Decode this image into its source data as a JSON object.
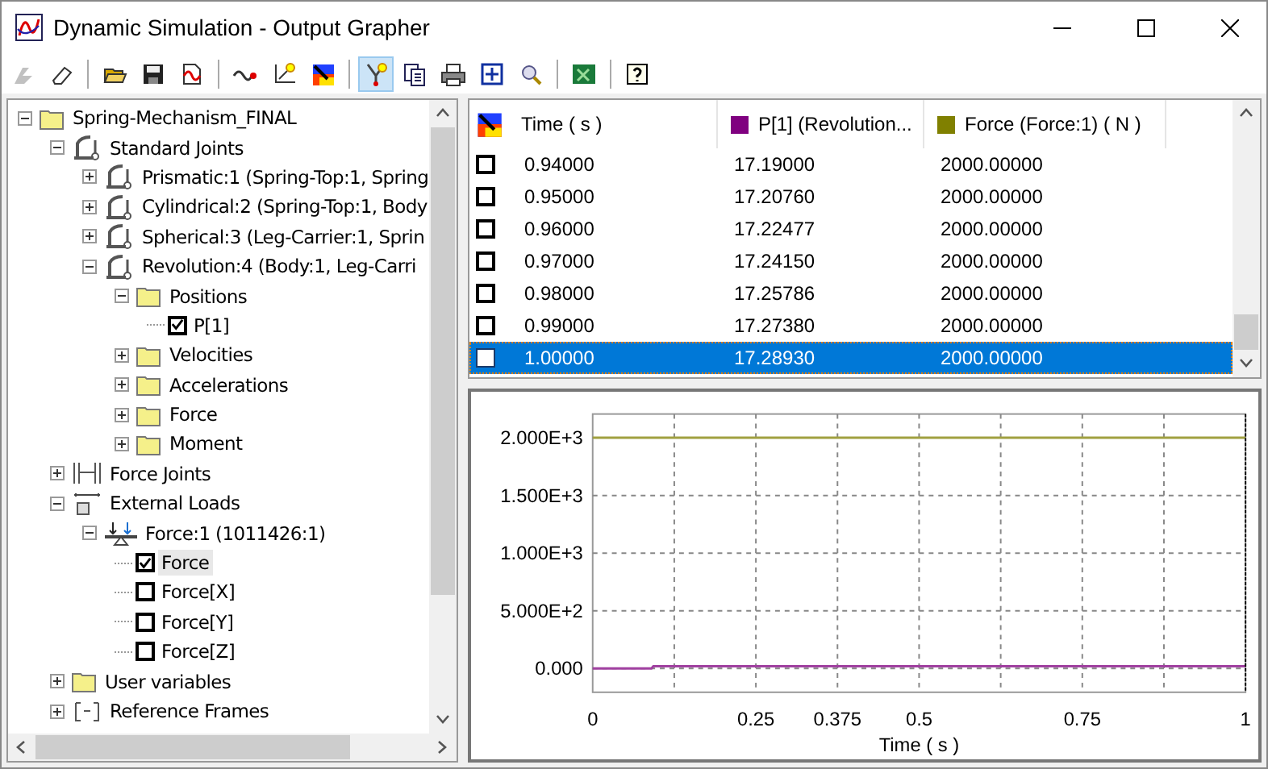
{
  "window": {
    "title": "Dynamic Simulation - Output Grapher"
  },
  "toolbar": [
    {
      "kind": "branch",
      "disabled": true,
      "on": false
    },
    {
      "kind": "eraser",
      "disabled": false,
      "on": false
    },
    {
      "kind": "sep"
    },
    {
      "kind": "open",
      "disabled": false,
      "on": false
    },
    {
      "kind": "save",
      "disabled": false,
      "on": false
    },
    {
      "kind": "export",
      "disabled": false,
      "on": false
    },
    {
      "kind": "sep"
    },
    {
      "kind": "curve",
      "disabled": false,
      "on": false
    },
    {
      "kind": "axes",
      "disabled": false,
      "on": false
    },
    {
      "kind": "colormap",
      "disabled": false,
      "on": false
    },
    {
      "kind": "sep"
    },
    {
      "kind": "cursor",
      "disabled": false,
      "on": true
    },
    {
      "kind": "copy",
      "disabled": false,
      "on": false
    },
    {
      "kind": "print",
      "disabled": false,
      "on": false
    },
    {
      "kind": "fit",
      "disabled": false,
      "on": false
    },
    {
      "kind": "zoom",
      "disabled": false,
      "on": false
    },
    {
      "kind": "sep"
    },
    {
      "kind": "excel",
      "disabled": false,
      "on": false
    },
    {
      "kind": "sep"
    },
    {
      "kind": "help",
      "disabled": false,
      "on": false
    }
  ],
  "tree": [
    {
      "kind": "folder",
      "label": "Spring-Mechanism_FINAL",
      "expanded": true,
      "children": [
        {
          "kind": "joint",
          "label": "Standard Joints",
          "expanded": true,
          "children": [
            {
              "kind": "joint",
              "label": "Prismatic:1 (Spring-Top:1, Spring",
              "expanded": false
            },
            {
              "kind": "joint",
              "label": "Cylindrical:2 (Spring-Top:1, Body",
              "expanded": false
            },
            {
              "kind": "joint",
              "label": "Spherical:3 (Leg-Carrier:1, Sprin",
              "expanded": false
            },
            {
              "kind": "joint",
              "label": "Revolution:4 (Body:1, Leg-Carri",
              "expanded": true,
              "children": [
                {
                  "kind": "folder",
                  "label": "Positions",
                  "expanded": true,
                  "children": [
                    {
                      "kind": "check",
                      "label": "P[1]",
                      "checked": true,
                      "selected": false
                    }
                  ]
                },
                {
                  "kind": "folder",
                  "label": "Velocities",
                  "expanded": false
                },
                {
                  "kind": "folder",
                  "label": "Accelerations",
                  "expanded": false
                },
                {
                  "kind": "folder",
                  "label": "Force",
                  "expanded": false
                },
                {
                  "kind": "folder",
                  "label": "Moment",
                  "expanded": false
                }
              ]
            }
          ]
        },
        {
          "kind": "forcejoint",
          "label": "Force Joints",
          "expanded": false
        },
        {
          "kind": "loads",
          "label": "External Loads",
          "expanded": true,
          "children": [
            {
              "kind": "force",
              "label": "Force:1 (1011426:1)",
              "expanded": true,
              "children": [
                {
                  "kind": "check",
                  "label": "Force",
                  "checked": true,
                  "selected": true
                },
                {
                  "kind": "check",
                  "label": "Force[X]",
                  "checked": false,
                  "selected": false
                },
                {
                  "kind": "check",
                  "label": "Force[Y]",
                  "checked": false,
                  "selected": false
                },
                {
                  "kind": "check",
                  "label": "Force[Z]",
                  "checked": false,
                  "selected": false
                }
              ]
            }
          ]
        },
        {
          "kind": "folder",
          "label": "User variables",
          "expanded": false
        },
        {
          "kind": "frames",
          "label": "Reference Frames",
          "expanded": false
        }
      ]
    }
  ],
  "table": {
    "columns": [
      {
        "label": "Time ( s )"
      },
      {
        "label": "P[1] (Revolution...",
        "color": "#800080"
      },
      {
        "label": "Force (Force:1) ( N )",
        "color": "#808000"
      }
    ],
    "rows": [
      {
        "checked": false,
        "selected": false,
        "cells": [
          "0.94000",
          "17.19000",
          "2000.00000"
        ]
      },
      {
        "checked": false,
        "selected": false,
        "cells": [
          "0.95000",
          "17.20760",
          "2000.00000"
        ]
      },
      {
        "checked": false,
        "selected": false,
        "cells": [
          "0.96000",
          "17.22477",
          "2000.00000"
        ]
      },
      {
        "checked": false,
        "selected": false,
        "cells": [
          "0.97000",
          "17.24150",
          "2000.00000"
        ]
      },
      {
        "checked": false,
        "selected": false,
        "cells": [
          "0.98000",
          "17.25786",
          "2000.00000"
        ]
      },
      {
        "checked": false,
        "selected": false,
        "cells": [
          "0.99000",
          "17.27380",
          "2000.00000"
        ]
      },
      {
        "checked": false,
        "selected": true,
        "cells": [
          "1.00000",
          "17.28930",
          "2000.00000"
        ]
      }
    ]
  },
  "graph": {
    "chart_data": {
      "type": "line",
      "xlabel": "Time ( s )",
      "x": [
        0,
        0.09,
        0.093,
        1
      ],
      "series": [
        {
          "color": "#a040a0",
          "values": [
            0,
            0,
            20,
            20
          ]
        },
        {
          "color": "#a0a040",
          "values": [
            2000,
            2000,
            2000,
            2000
          ]
        }
      ],
      "xlim": [
        0,
        1
      ],
      "ylim": [
        -206,
        2206
      ],
      "grid": true,
      "xticks": [
        0,
        0.25,
        0.375,
        0.5,
        0.75,
        1
      ],
      "yticks": [
        {
          "value": 0,
          "label": "0.000"
        },
        {
          "value": 500,
          "label": "5.000E+2"
        },
        {
          "value": 1000,
          "label": "1.000E+3"
        },
        {
          "value": 1500,
          "label": "1.500E+3"
        },
        {
          "value": 2000,
          "label": "2.000E+3"
        }
      ]
    }
  }
}
